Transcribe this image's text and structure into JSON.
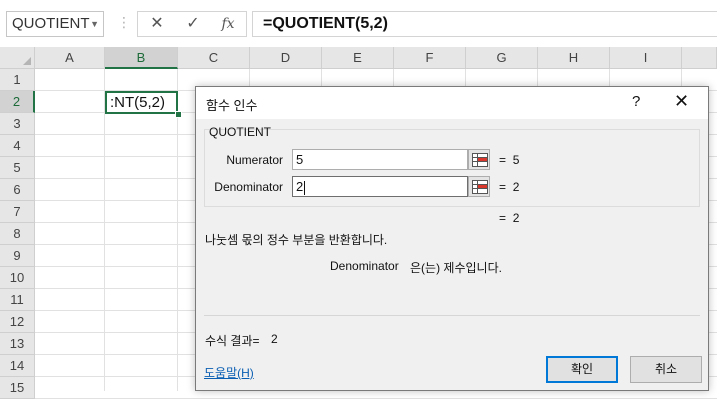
{
  "formula_bar": {
    "name_box": "QUOTIENT",
    "cancel_glyph": "✕",
    "enter_glyph": "✓",
    "fx_glyph": "fx",
    "formula": "=QUOTIENT(5,2)"
  },
  "sheet": {
    "columns": [
      "A",
      "B",
      "C",
      "D",
      "E",
      "F",
      "G",
      "H",
      "I"
    ],
    "rows": [
      "1",
      "2",
      "3",
      "4",
      "5",
      "6",
      "7",
      "8",
      "9",
      "10",
      "11",
      "12",
      "13",
      "14",
      "15"
    ],
    "selected_column": "B",
    "selected_row": "2",
    "active_cell_text": ":NT(5,2)"
  },
  "dialog": {
    "title": "함수 인수",
    "help_button": "?",
    "close_button": "✕",
    "function_name": "QUOTIENT",
    "args": [
      {
        "label": "Numerator",
        "value": "5",
        "result_eq": "=",
        "result": "5"
      },
      {
        "label": "Denominator",
        "value": "2",
        "result_eq": "=",
        "result": "2"
      }
    ],
    "function_result_eq": "=",
    "function_result": "2",
    "description": "나눗셈 몫의 정수 부분을 반환합니다.",
    "arg_description_name": "Denominator",
    "arg_description_text": "은(는) 제수입니다.",
    "formula_result_label": "수식 결과=",
    "formula_result_value": "2",
    "help_link": "도움말(H)",
    "ok_button": "확인",
    "cancel_button": "취소"
  },
  "colors": {
    "excel_green": "#217346",
    "focus_blue": "#0078d7",
    "link_blue": "#0b5fb3",
    "dialog_bg": "#f0f0f0"
  }
}
